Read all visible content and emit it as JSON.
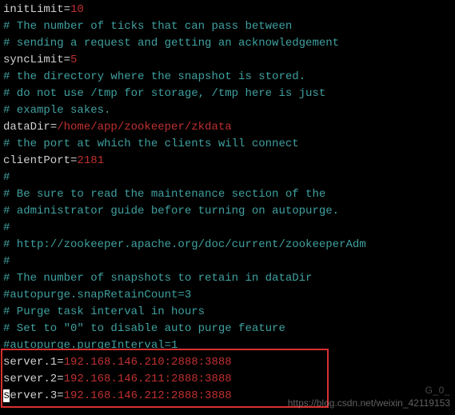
{
  "lines": {
    "l00a": "initLimit",
    "l00b": "=",
    "l00c": "10",
    "l01": "# The number of ticks that can pass between",
    "l02": "# sending a request and getting an acknowledgement",
    "l03a": "syncLimit",
    "l03b": "=",
    "l03c": "5",
    "l04": "# the directory where the snapshot is stored.",
    "l05": "# do not use /tmp for storage, /tmp here is just",
    "l06": "# example sakes.",
    "l07a": "dataDir",
    "l07b": "=",
    "l07c": "/home/app/zookeeper/zkdata",
    "l08": "",
    "l09": "# the port at which the clients will connect",
    "l10a": "clientPort",
    "l10b": "=",
    "l10c": "2181",
    "l11": "#",
    "l12": "# Be sure to read the maintenance section of the",
    "l13": "# administrator guide before turning on autopurge.",
    "l14": "#",
    "l15": "# http://zookeeper.apache.org/doc/current/zookeeperAdm",
    "l16": "#",
    "l17": "# The number of snapshots to retain in dataDir",
    "l18": "#autopurge.snapRetainCount=3",
    "l19": "# Purge task interval in hours",
    "l20": "# Set to \"0\" to disable auto purge feature",
    "l21": "#autopurge.purgeInterval=1",
    "l22a": "server.1",
    "l22b": "=",
    "l22c": "192.168.146.210:2888:3888",
    "l23a": "server.2",
    "l23b": "=",
    "l23c": "192.168.146.211:2888:3888",
    "l24cur": "s",
    "l24a": "erver.3",
    "l24b": "=",
    "l24c": "192.168.146.212:2888:3888"
  },
  "watermark": {
    "line1": "https://blog.csdn.net/weixin_42119153",
    "line2": "G_0_"
  }
}
